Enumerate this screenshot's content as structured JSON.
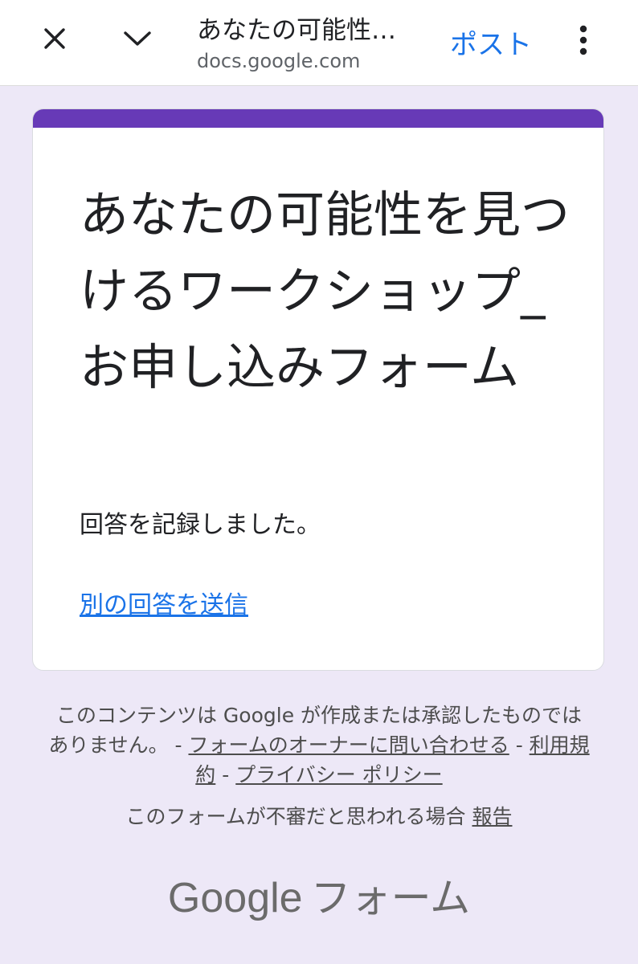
{
  "topbar": {
    "title": "あなたの可能性…",
    "url": "docs.google.com",
    "post_label": "ポスト",
    "icons": [
      "close-icon",
      "chevron-down-icon",
      "more-vert-icon"
    ]
  },
  "form": {
    "title": "あなたの可能性を見つけるワークショップ_お申し込みフォーム",
    "confirmation": "回答を記録しました。",
    "submit_another": "別の回答を送信"
  },
  "footer": {
    "disclaimer_text": "このコンテンツは Google が作成または承認したものではありません。 -",
    "contact_owner": "フォームのオーナーに問い合わせる",
    "sep1": " - ",
    "terms": "利用規約",
    "sep2": " - ",
    "privacy": "プライバシー ポリシー",
    "report_text": "このフォームが不審だと思われる場合",
    "report_link": "報告",
    "brand_google": "Google",
    "brand_forms": "フォーム"
  },
  "colors": {
    "accent": "#673ab7",
    "link": "#1a73e8",
    "background": "#ede8f7"
  }
}
